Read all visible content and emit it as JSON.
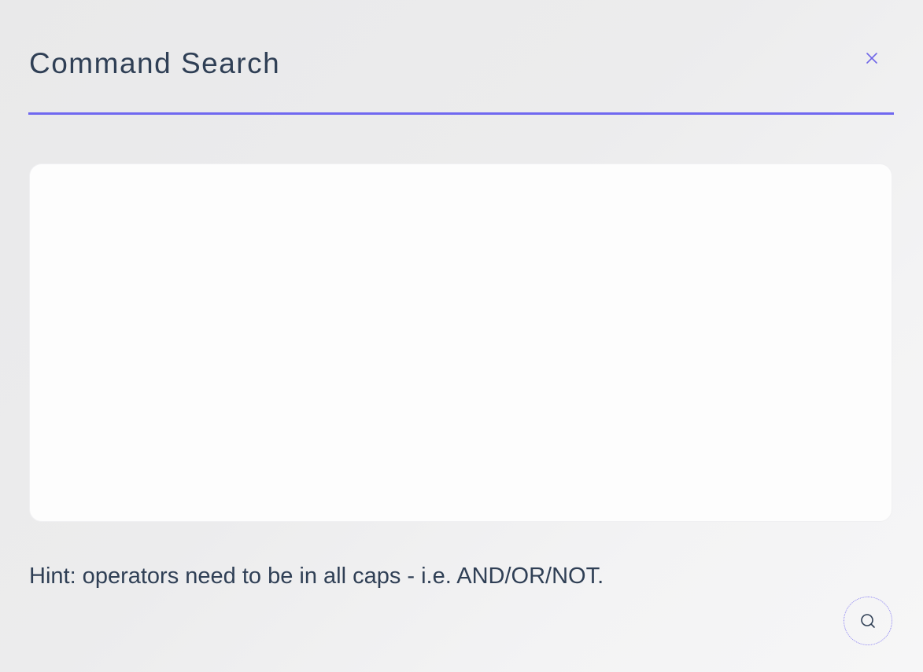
{
  "dialog": {
    "title": "Command Search",
    "close_icon": "close-icon",
    "accent_color": "#7068f0"
  },
  "search": {
    "value": "",
    "placeholder": ""
  },
  "hint": {
    "text": "Hint: operators need to be in all caps - i.e. AND/OR/NOT."
  },
  "submit": {
    "icon": "search-icon"
  }
}
